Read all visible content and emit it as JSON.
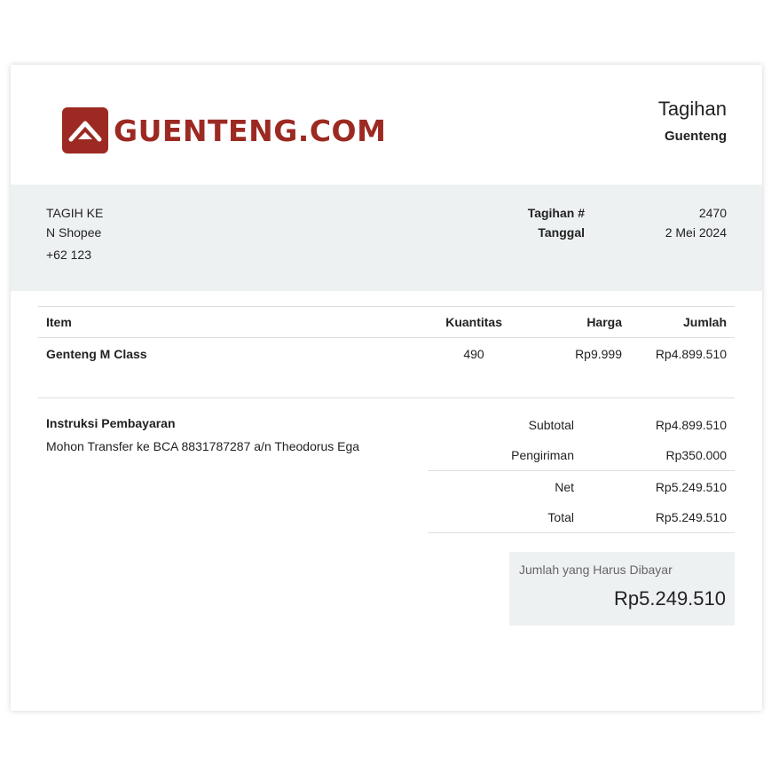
{
  "header": {
    "brand": "GUENTENG.COM",
    "title": "Tagihan",
    "company": "Guenteng"
  },
  "bill_to": {
    "heading": "TAGIH KE",
    "name": "N Shopee",
    "phone": "+62 123"
  },
  "meta": {
    "invoice_label": "Tagihan #",
    "invoice_number": "2470",
    "date_label": "Tanggal",
    "date": "2 Mei 2024"
  },
  "table": {
    "headers": {
      "item": "Item",
      "quantity": "Kuantitas",
      "price": "Harga",
      "amount": "Jumlah"
    },
    "rows": [
      {
        "item": "Genteng M Class",
        "quantity": "490",
        "price": "Rp9.999",
        "amount": "Rp4.899.510"
      }
    ]
  },
  "payment": {
    "heading": "Instruksi Pembayaran",
    "text": "Mohon Transfer ke BCA 8831787287 a/n Theodorus Ega"
  },
  "summary": {
    "subtotal_label": "Subtotal",
    "subtotal": "Rp4.899.510",
    "shipping_label": "Pengiriman",
    "shipping": "Rp350.000",
    "net_label": "Net",
    "net": "Rp5.249.510",
    "total_label": "Total",
    "total": "Rp5.249.510"
  },
  "amount_due": {
    "label": "Jumlah yang Harus Dibayar",
    "value": "Rp5.249.510"
  },
  "colors": {
    "brand": "#9c2a22",
    "band": "#eef1f2"
  }
}
